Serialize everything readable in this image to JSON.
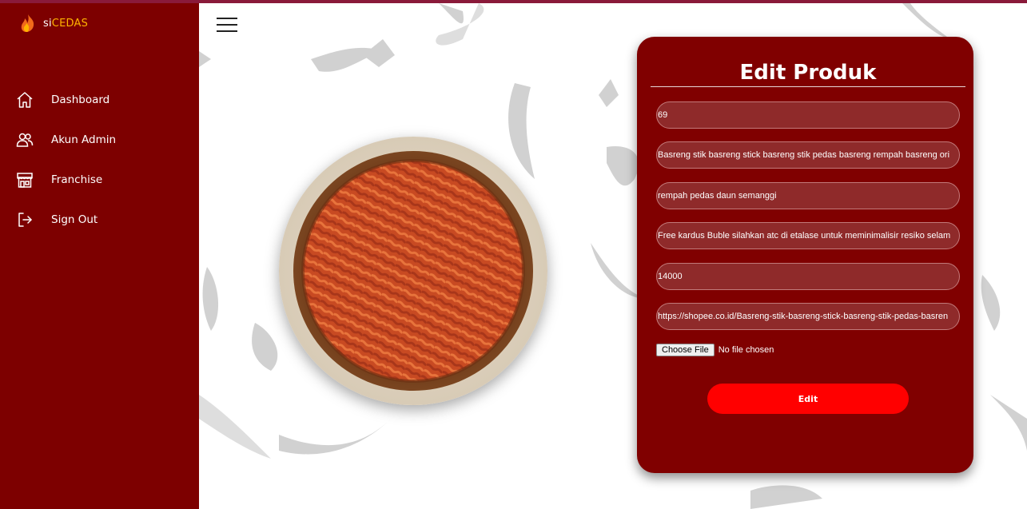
{
  "brand": {
    "prefix": "si",
    "name": "CEDAS"
  },
  "sidebar": {
    "items": [
      {
        "label": "Dashboard",
        "icon": "home-icon"
      },
      {
        "label": "Akun Admin",
        "icon": "users-icon"
      },
      {
        "label": "Franchise",
        "icon": "store-icon"
      },
      {
        "label": "Sign Out",
        "icon": "sign-out-icon"
      }
    ]
  },
  "form": {
    "title": "Edit Produk",
    "fields": [
      {
        "value": "69"
      },
      {
        "value": "Basreng stik basreng stick basreng stik pedas basreng rempah basreng ori"
      },
      {
        "value": "rempah pedas daun semanggi"
      },
      {
        "value": "Free kardus Buble silahkan atc di etalase untuk meminimalisir resiko selam"
      },
      {
        "value": "14000"
      },
      {
        "value": "https://shopee.co.id/Basreng-stik-basreng-stick-basreng-stik-pedas-basren"
      }
    ],
    "file_button": "Choose File",
    "file_status": "No file chosen",
    "submit_label": "Edit"
  },
  "colors": {
    "sidebar": "#7d0000",
    "card": "#800000",
    "field": "#8f2a2a",
    "button": "#ff0000",
    "brand_accent": "#ffb400"
  }
}
